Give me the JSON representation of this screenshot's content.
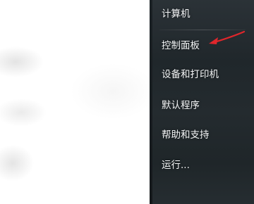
{
  "start_menu": {
    "items": [
      {
        "label": "计算机"
      },
      {
        "label": "控制面板"
      },
      {
        "label": "设备和打印机"
      },
      {
        "label": "默认程序"
      },
      {
        "label": "帮助和支持"
      },
      {
        "label": "运行..."
      }
    ]
  },
  "annotation": {
    "arrow_color": "#e0262b"
  }
}
